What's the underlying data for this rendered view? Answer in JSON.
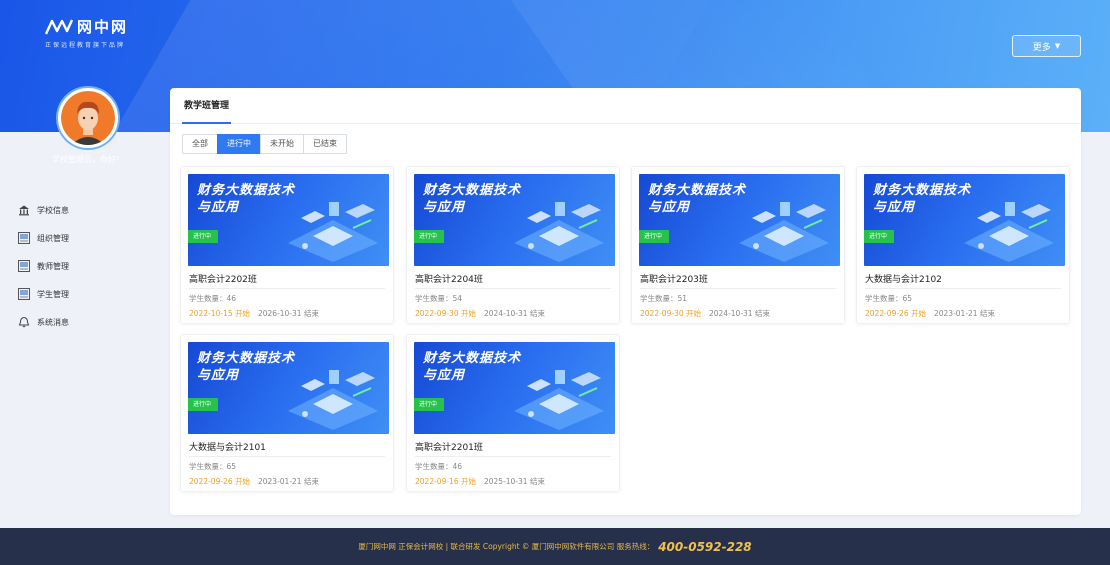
{
  "brand": {
    "name": "网中网",
    "slogan": "正保远程教育旗下品牌"
  },
  "header": {
    "more_label": "更多"
  },
  "user": {
    "greeting": "学校管理员，你好！"
  },
  "nav": {
    "items": [
      {
        "label": "学校信息",
        "icon": "school-icon"
      },
      {
        "label": "组织管理",
        "icon": "org-icon"
      },
      {
        "label": "教师管理",
        "icon": "teacher-icon"
      },
      {
        "label": "学生管理",
        "icon": "student-icon"
      },
      {
        "label": "系统消息",
        "icon": "bell-icon"
      }
    ]
  },
  "panel": {
    "title": "教学班管理",
    "tabs": [
      {
        "label": "全部",
        "active": false
      },
      {
        "label": "进行中",
        "active": true
      },
      {
        "label": "未开始",
        "active": false
      },
      {
        "label": "已结束",
        "active": false
      }
    ]
  },
  "cards": [
    {
      "banner_title": "财务大数据技术与应用",
      "status": "进行中",
      "name": "高职会计2202班",
      "count": "学生数量：46",
      "start": "2022-10-15 开始",
      "end": "2026-10-31 结束"
    },
    {
      "banner_title": "财务大数据技术与应用",
      "status": "进行中",
      "name": "高职会计2204班",
      "count": "学生数量：54",
      "start": "2022-09-30 开始",
      "end": "2024-10-31 结束"
    },
    {
      "banner_title": "财务大数据技术与应用",
      "status": "进行中",
      "name": "高职会计2203班",
      "count": "学生数量：51",
      "start": "2022-09-30 开始",
      "end": "2024-10-31 结束"
    },
    {
      "banner_title": "财务大数据技术与应用",
      "status": "进行中",
      "name": "大数据与会计2102",
      "count": "学生数量：65",
      "start": "2022-09-26 开始",
      "end": "2023-01-21 结束"
    },
    {
      "banner_title": "财务大数据技术与应用",
      "status": "进行中",
      "name": "大数据与会计2101",
      "count": "学生数量：65",
      "start": "2022-09-26 开始",
      "end": "2023-01-21 结束"
    },
    {
      "banner_title": "财务大数据技术与应用",
      "status": "进行中",
      "name": "高职会计2201班",
      "count": "学生数量：46",
      "start": "2022-09-16 开始",
      "end": "2025-10-31 结束"
    }
  ],
  "footer": {
    "text": "厦门网中网 正保会计网校 | 联合研发 Copyright © 厦门网中网软件有限公司 服务热线：",
    "hotline": "400-0592-228"
  },
  "colors": {
    "accent": "#2f7af0",
    "badge": "#27c24c",
    "start_date": "#f0a020",
    "footer_bg": "#27304a"
  }
}
